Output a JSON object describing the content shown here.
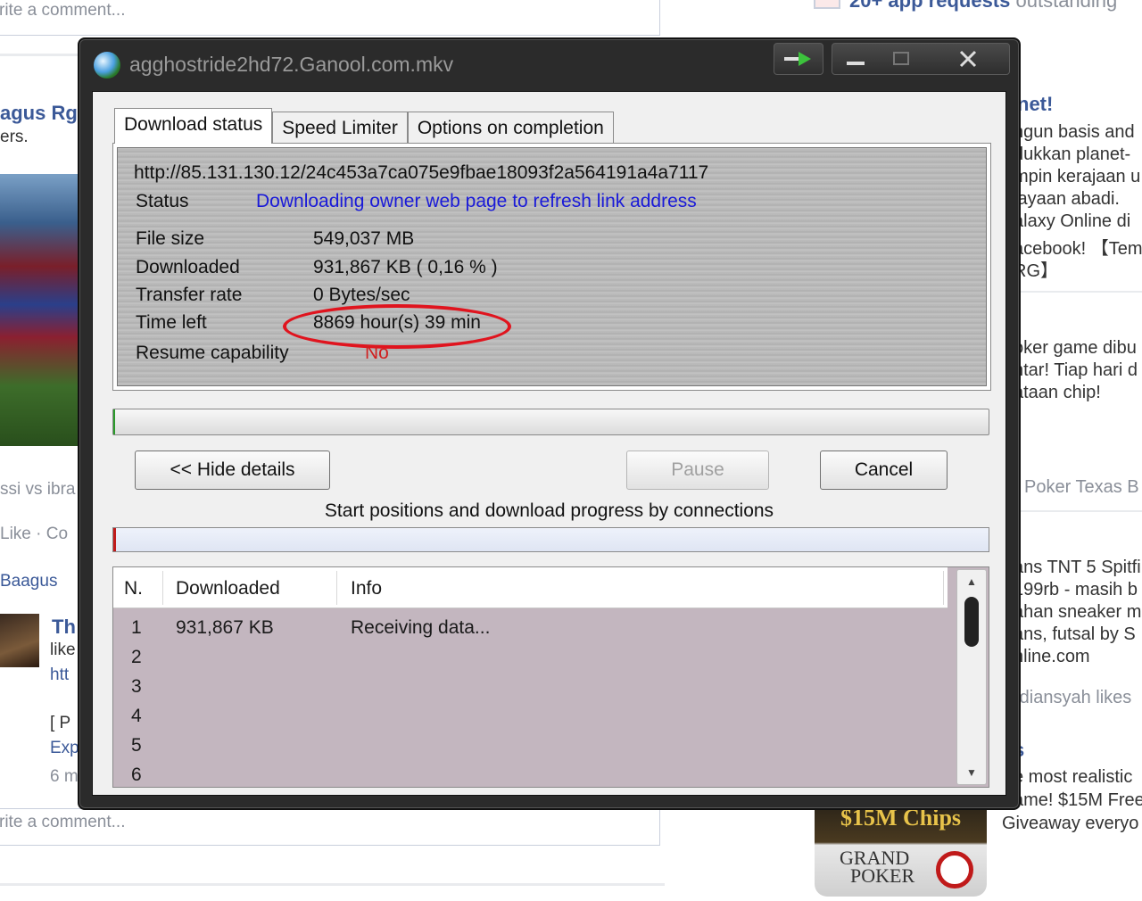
{
  "background": {
    "top_request": {
      "bold": "20+ app requests",
      "rest": "outstanding"
    },
    "comment_placeholder_top": "rite a comment...",
    "comment_placeholder_bottom": "rite a comment...",
    "left_name": "agus Rg",
    "left_sub": "ers.",
    "photo_caption": "ssi vs ibra",
    "like_text": "Like · Co",
    "commenter": "Baagus",
    "post_line1": "Th",
    "post_line2": "like",
    "post_line3": "htt",
    "post_line4": "[ P",
    "post_line5": "Exp",
    "post_line6": "6 m",
    "right_ad_title": "net!",
    "right_ad_lines": [
      "ngun basis and",
      "dukkan planet-",
      "mpin kerajaan u",
      "jayaan abadi.",
      "alaxy Online di",
      "acebook! 【Tem",
      "RG】"
    ],
    "right_ad2_lines": [
      "oker game dibu",
      "ntar! Tiap hari d",
      "ataan chip!"
    ],
    "right_ad2_grey": "Poker Texas B",
    "right_ad3_lines": [
      "ans TNT 5 Spitfi",
      "199rb - masih b",
      "ahan sneaker m",
      "ans, futsal by S",
      "nline.com"
    ],
    "right_ad3_grey": "rdiansyah likes",
    "right_ad4_title": "s",
    "right_ad4_lines": [
      "e most realistic",
      "ame! $15M Free",
      "Giveaway everyo"
    ],
    "poker_chips": "$15M Chips",
    "poker_logo_1": "GRAND",
    "poker_logo_2": "POKER"
  },
  "window": {
    "title": "agghostride2hd72.Ganool.com.mkv",
    "tabs": [
      {
        "label": "Download status",
        "active": true
      },
      {
        "label": "Speed Limiter",
        "active": false
      },
      {
        "label": "Options on completion",
        "active": false
      }
    ],
    "details": {
      "url": "http://85.131.130.12/24c453a7ca075e9fbae18093f2a564191a4a7117",
      "status_label": "Status",
      "status_value": "Downloading owner web page to refresh link address",
      "file_size_label": "File size",
      "file_size_value": "549,037  MB",
      "downloaded_label": "Downloaded",
      "downloaded_value": "931,867  KB  ( 0,16 % )",
      "transfer_label": "Transfer rate",
      "transfer_value": "0  Bytes/sec",
      "time_left_label": "Time left",
      "time_left_value": "8869 hour(s) 39 min",
      "resume_label": "Resume capability",
      "resume_value": "No"
    },
    "progress_fraction": 0.0016,
    "buttons": {
      "hide_details": "<< Hide details",
      "pause": "Pause",
      "cancel": "Cancel"
    },
    "connections_caption": "Start positions and download progress by connections",
    "list": {
      "headers": [
        "N.",
        "Downloaded",
        "Info"
      ],
      "rows": [
        {
          "n": "1",
          "downloaded": "931,867  KB",
          "info": "Receiving data..."
        },
        {
          "n": "2",
          "downloaded": "",
          "info": ""
        },
        {
          "n": "3",
          "downloaded": "",
          "info": ""
        },
        {
          "n": "4",
          "downloaded": "",
          "info": ""
        },
        {
          "n": "5",
          "downloaded": "",
          "info": ""
        },
        {
          "n": "6",
          "downloaded": "",
          "info": ""
        }
      ]
    },
    "icons": {
      "app": "idm-globe-icon",
      "arrow": "green-arrow-icon",
      "minimize": "minimize-icon",
      "maximize": "maximize-icon",
      "close": "close-icon"
    },
    "colors": {
      "status_link": "#1a1ad8",
      "resume_no": "#d02020",
      "annotation_ellipse": "#e0141e",
      "list_background": "#c3b6bf"
    }
  }
}
